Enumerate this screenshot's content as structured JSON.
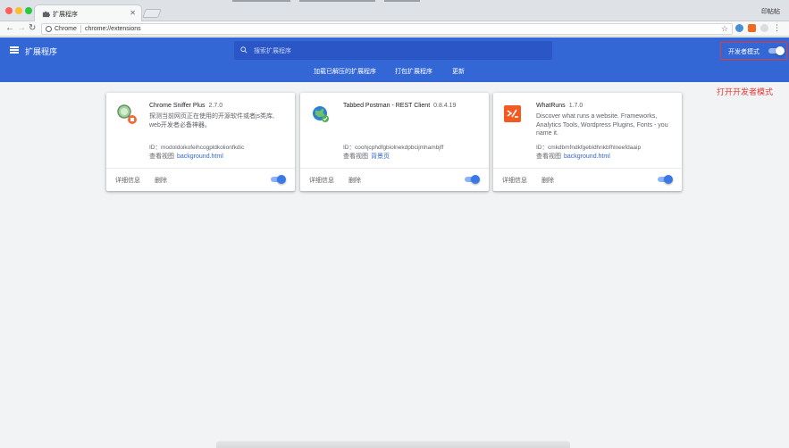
{
  "browser": {
    "tab_title": "扩展程序",
    "profile_name": "印帖帖",
    "site_label": "Chrome",
    "url": "chrome://extensions",
    "traffic_colors": [
      "#ff5f57",
      "#febc2e",
      "#28c840"
    ]
  },
  "header": {
    "title": "扩展程序",
    "search_placeholder": "搜索扩展程序",
    "dev_mode_label": "开发者模式",
    "dev_mode_on": true,
    "accent_color": "#3367d6",
    "actions": [
      "加载已解压的扩展程序",
      "打包扩展程序",
      "更新"
    ]
  },
  "annotation": "打开开发者模式",
  "extensions": [
    {
      "name": "Chrome Sniffer Plus",
      "version": "2.7.0",
      "description": "探测当前网页正在使用的开源软件或者js类库, web开发者必备神器。",
      "id_label": "ID：",
      "id": "modoldoikofeihcogpldkolionfkdic",
      "views_label": "查看视图",
      "view_link": "background.html",
      "details_label": "详细信息",
      "remove_label": "删除",
      "enabled": true,
      "icon": "magnifier-icon"
    },
    {
      "name": "Tabbed Postman - REST Client",
      "version": "0.8.4.19",
      "description": "",
      "id_label": "ID：",
      "id": "coohjcphdfgbiolnekdpbcijmhambjff",
      "views_label": "查看视图",
      "view_link": "背景页",
      "details_label": "详细信息",
      "remove_label": "删除",
      "enabled": true,
      "icon": "globe-icon"
    },
    {
      "name": "WhatRuns",
      "version": "1.7.0",
      "description": "Discover what runs a website. Frameworks, Analytics Tools, Wordpress Plugins, Fonts - you name it.",
      "id_label": "ID：",
      "id": "cmkdbmfndkfgebldhnkbfhlneefdaaip",
      "views_label": "查看视图",
      "view_link": "background.html",
      "details_label": "详细信息",
      "remove_label": "删除",
      "enabled": true,
      "icon": "whatruns-icon"
    }
  ]
}
